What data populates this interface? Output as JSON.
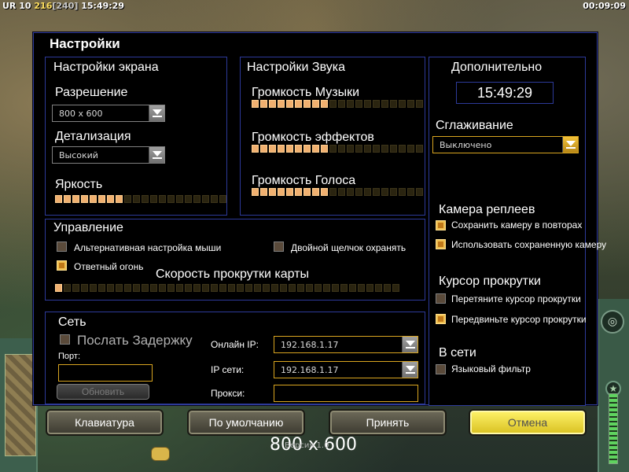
{
  "hud": {
    "rank": "UR",
    "level": "10",
    "credits": "216",
    "credits_bracket": "[240]",
    "clock_left": "15:49:29",
    "clock_right": "00:09:09"
  },
  "dialog": {
    "title": "Настройки"
  },
  "screen": {
    "title": "Настройки экрана",
    "resolution_label": "Разрешение",
    "resolution_value": "800 x 600",
    "detail_label": "Детализация",
    "detail_value": "Высокий",
    "brightness_label": "Яркость",
    "brightness_level": 8,
    "brightness_steps": 20
  },
  "sound": {
    "title": "Настройки Звука",
    "music_label": "Громкость Музыки",
    "music_level": 9,
    "effects_label": "Громкость эффектов",
    "effects_level": 9,
    "voice_label": "Громкость Голоса",
    "voice_level": 9,
    "steps": 20
  },
  "extra": {
    "title": "Дополнительно",
    "clock": "15:49:29",
    "antialias_label": "Сглаживание",
    "antialias_value": "Выключено",
    "replay_camera_label": "Камера реплеев",
    "save_camera_label": "Сохранить камеру в повторах",
    "save_camera_checked": true,
    "use_saved_camera_label": "Использовать сохраненную камеру",
    "use_saved_camera_checked": true,
    "scroll_cursor_label": "Курсор прокрутки",
    "drag_cursor_label": "Перетяните курсор прокрутки",
    "drag_cursor_checked": false,
    "move_cursor_label": "Передвиньте курсор прокрутки",
    "move_cursor_checked": true,
    "online_label": "В сети",
    "lang_filter_label": "Языковый фильтр",
    "lang_filter_checked": false
  },
  "controls": {
    "title": "Управление",
    "alt_mouse_label": "Альтернативная настройка мыши",
    "alt_mouse_checked": false,
    "double_click_label": "Двойной щелчок охранять",
    "double_click_checked": false,
    "return_fire_label": "Ответный огонь",
    "return_fire_checked": true,
    "scroll_speed_label": "Скорость прокрутки карты",
    "scroll_speed_level": 1,
    "scroll_speed_steps": 40
  },
  "network": {
    "title": "Сеть",
    "send_delay_label": "Послать Задержку",
    "send_delay_checked": false,
    "port_label": "Порт:",
    "port_value": "",
    "refresh_label": "Обновить",
    "online_ip_label": "Онлайн IP:",
    "online_ip_value": "192.168.1.17",
    "net_ip_label": "IP сети:",
    "net_ip_value": "192.168.1.17",
    "proxy_label": "Прокси:",
    "proxy_value": ""
  },
  "buttons": {
    "keyboard": "Клавиатура",
    "defaults": "По умолчанию",
    "accept": "Принять",
    "cancel": "Отмена"
  },
  "overlay": {
    "resolution": "800 x 600",
    "version": "Версия 1.0"
  },
  "colors": {
    "border_blue": "#2d3a9a",
    "slider_on": "#f0b070",
    "gold": "#d9a520",
    "cancel_button": "#f0e040"
  }
}
